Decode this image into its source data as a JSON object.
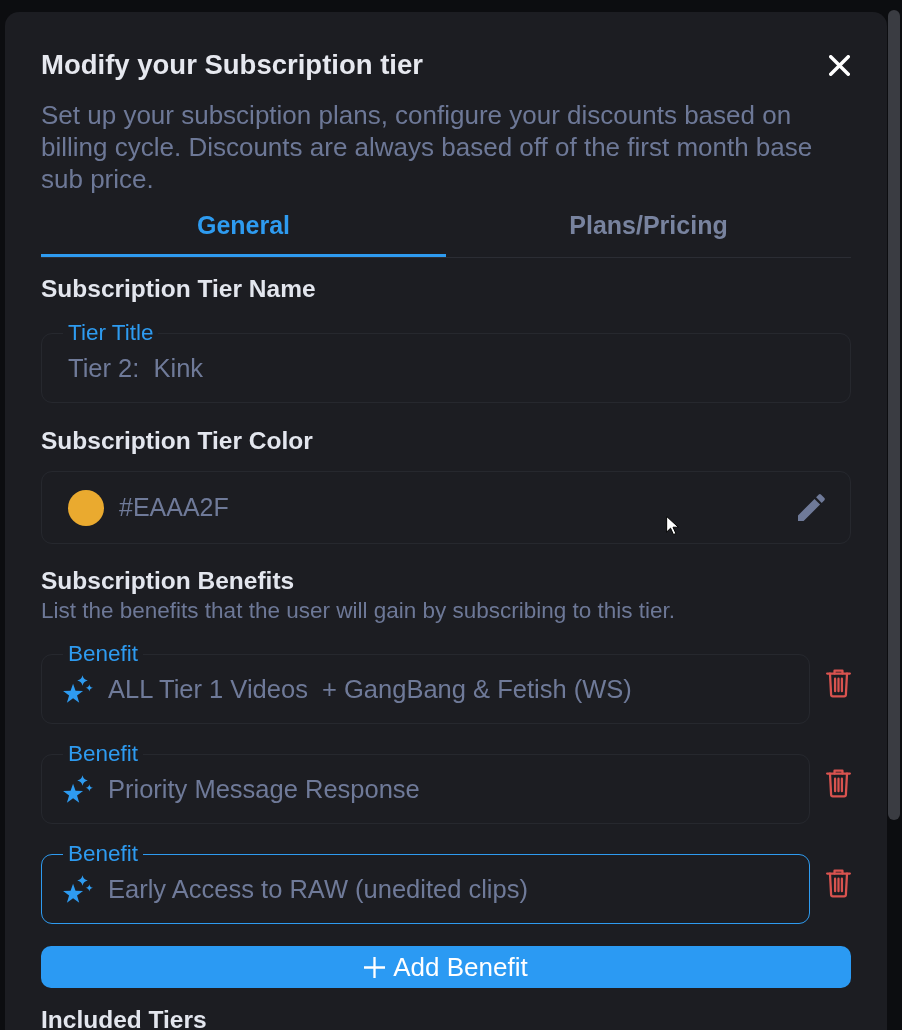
{
  "dialog": {
    "title": "Modify your Subscription tier",
    "description": "Set up your subsciption plans, configure your discounts based on billing cycle. Discounts are always based off of the first month base sub price."
  },
  "tabs": [
    {
      "label": "General",
      "selected": true
    },
    {
      "label": "Plans/Pricing",
      "selected": false
    }
  ],
  "tier_name": {
    "heading": "Subscription Tier Name",
    "field": {
      "label": "Tier Title",
      "value": "Tier 2:  Kink",
      "focused": false
    }
  },
  "tier_color": {
    "heading": "Subscription Tier Color",
    "color": "#eaaa2f",
    "value": "#EAAA2F"
  },
  "benefits": {
    "heading": "Subscription Benefits",
    "hint": "List the benefits that the user will gain by subscribing to this tier.",
    "items": [
      {
        "label": "Benefit",
        "value": "ALL Tier 1 Videos  + GangBang & Fetish (WS)",
        "focused": false
      },
      {
        "label": "Benefit",
        "value": "Priority Message Response",
        "focused": false
      },
      {
        "label": "Benefit",
        "value": "Early Access to RAW (unedited clips)",
        "focused": true
      }
    ],
    "add_button": "Add Benefit"
  },
  "included_tiers": {
    "heading": "Included Tiers"
  }
}
